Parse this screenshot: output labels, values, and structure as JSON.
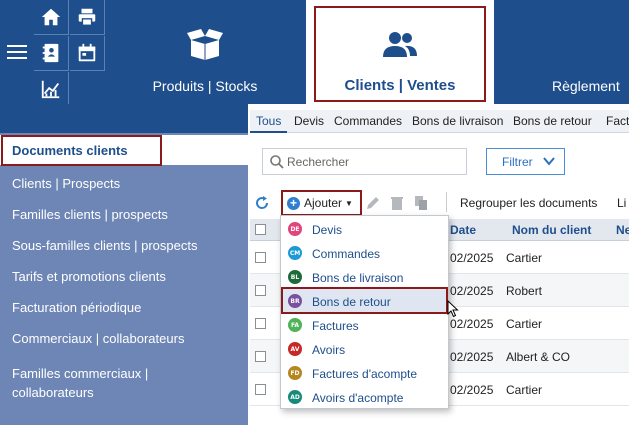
{
  "topbar": {
    "modules": [
      {
        "label": "Produits | Stocks"
      },
      {
        "label": "Clients | Ventes"
      },
      {
        "label": "Règlement"
      }
    ]
  },
  "sidebar": {
    "active_item": "Documents clients",
    "items": [
      "Clients | Prospects",
      "Familles clients | prospects",
      "Sous-familles clients | prospects",
      "Tarifs et promotions clients",
      "Facturation périodique",
      "Commerciaux | collaborateurs",
      "Familles commerciaux |",
      "collaborateurs"
    ]
  },
  "tabs": [
    "Tous",
    "Devis",
    "Commandes",
    "Bons de livraison",
    "Bons de retour",
    "Fact"
  ],
  "search": {
    "placeholder": "Rechercher"
  },
  "filter": {
    "label": "Filtrer"
  },
  "toolbar": {
    "add_label": "Ajouter",
    "regroup_label": "Regrouper les documents",
    "more_label": "Li"
  },
  "table": {
    "headers": [
      "Date",
      "Nom du client",
      "Ne"
    ],
    "rows": [
      {
        "date": "02/2025",
        "client": "Cartier"
      },
      {
        "date": "02/2025",
        "client": "Robert"
      },
      {
        "date": "02/2025",
        "client": "Cartier"
      },
      {
        "date": "02/2025",
        "client": "Albert & CO"
      },
      {
        "date": "02/2025",
        "client": "Cartier"
      }
    ]
  },
  "dropdown": {
    "items": [
      {
        "badge": "DE",
        "label": "Devis",
        "color": "#e0457b"
      },
      {
        "badge": "CM",
        "label": "Commandes",
        "color": "#1b9ad6"
      },
      {
        "badge": "BL",
        "label": "Bons de livraison",
        "color": "#1e6b3a"
      },
      {
        "badge": "BR",
        "label": "Bons de retour",
        "color": "#7b4fa0"
      },
      {
        "badge": "FA",
        "label": "Factures",
        "color": "#4fb35a"
      },
      {
        "badge": "AV",
        "label": "Avoirs",
        "color": "#c62828"
      },
      {
        "badge": "FD",
        "label": "Factures d'acompte",
        "color": "#b5871e"
      },
      {
        "badge": "AD",
        "label": "Avoirs d'acompte",
        "color": "#178a7a"
      }
    ]
  }
}
